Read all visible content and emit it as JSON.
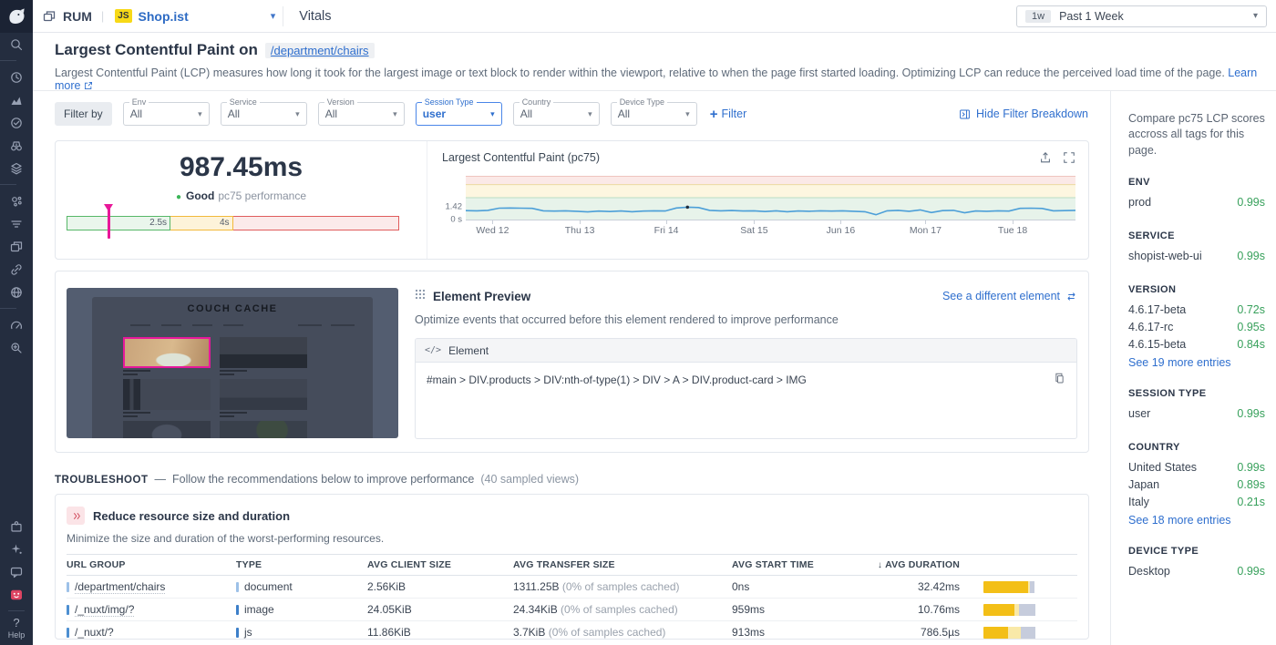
{
  "topbar": {
    "app_label": "RUM",
    "service_badge": "JS",
    "service_name": "Shop.ist",
    "tab_label": "Vitals",
    "time_range": {
      "badge": "1w",
      "label": "Past 1 Week"
    }
  },
  "icons": {
    "caret_down": "▾",
    "sort_down": "↓",
    "status_dot": "●",
    "dash": "—"
  },
  "sidebar": {
    "groups": [
      [
        "search"
      ],
      [
        "history",
        "bar-chart",
        "check-gauge",
        "binoculars",
        "layers"
      ],
      [
        "dot-cluster",
        "filter-lines",
        "browser-frames",
        "link",
        "globe"
      ],
      [
        "speedometer",
        "search-gear"
      ]
    ],
    "bottom_groups": [
      [
        "puzzle",
        "sparkles",
        "chat-bubble",
        "dog-alert"
      ]
    ],
    "help_label": "Help"
  },
  "header": {
    "title": "Largest Contentful Paint on",
    "path_chip": "/department/chairs",
    "description": "Largest Contentful Paint (LCP) measures how long it took for the largest image or text block to render within the viewport, relative to when the page first started loading. Optimizing LCP can reduce the perceived load time of the page.",
    "learn_more": "Learn more"
  },
  "filters": {
    "filter_by_label": "Filter by",
    "dropdowns": [
      {
        "label": "Env",
        "value": "All",
        "active": false
      },
      {
        "label": "Service",
        "value": "All",
        "active": false
      },
      {
        "label": "Version",
        "value": "All",
        "active": false
      },
      {
        "label": "Session Type",
        "value": "user",
        "active": true
      },
      {
        "label": "Country",
        "value": "All",
        "active": false
      },
      {
        "label": "Device Type",
        "value": "All",
        "active": false
      }
    ],
    "add_filter_label": "Filter",
    "hide_breakdown_label": "Hide Filter Breakdown"
  },
  "overview": {
    "value": "987.45ms",
    "status_word": "Good",
    "status_rest": "pc75 performance",
    "gauge": {
      "good": 2.5,
      "poor": 4,
      "max": 8,
      "value_s": 0.98745,
      "good_label": "2.5s",
      "poor_label": "4s"
    }
  },
  "chart_data": {
    "type": "line",
    "title": "Largest Contentful Paint (pc75)",
    "unit": "s",
    "ylim": [
      0,
      5
    ],
    "thresholds": {
      "good": 2.5,
      "poor": 4
    },
    "y_axis_labels": [
      {
        "text": "1.42",
        "value": 1.42
      },
      {
        "text": "0 s",
        "value": 0
      }
    ],
    "x_labels": [
      "Wed 12",
      "Thu 13",
      "Fri 14",
      "Sat 15",
      "Jun 16",
      "Mon 17",
      "Tue 18"
    ],
    "x_tick_fracs": [
      0.044,
      0.187,
      0.329,
      0.473,
      0.615,
      0.754,
      0.897
    ],
    "values": [
      1.02,
      1.0,
      1.05,
      1.3,
      1.32,
      1.3,
      1.28,
      1.0,
      0.97,
      1.0,
      0.95,
      0.88,
      0.97,
      0.92,
      0.98,
      0.9,
      0.97,
      1.0,
      0.98,
      1.32,
      1.42,
      1.38,
      1.05,
      1.0,
      1.03,
      0.98,
      1.0,
      0.92,
      1.0,
      0.9,
      0.98,
      0.95,
      1.0,
      0.97,
      1.0,
      0.95,
      0.9,
      0.55,
      1.0,
      1.05,
      0.95,
      1.1,
      0.8,
      1.02,
      1.05,
      0.78,
      0.98,
      0.95,
      1.0,
      0.97,
      1.28,
      1.3,
      1.27,
      1.0,
      1.02,
      1.05
    ],
    "marker_index": 20,
    "legend": []
  },
  "element_preview": {
    "title": "Element Preview",
    "link": "See a different element",
    "description": "Optimize events that occurred before this element rendered to improve performance",
    "panel_icon": "</>",
    "panel_title": "Element",
    "selector": "#main > DIV.products > DIV:nth-of-type(1) > DIV > A > DIV.product-card > IMG",
    "image_title": "COUCH CACHE"
  },
  "troubleshoot": {
    "label": "TROUBLESHOOT",
    "dash": "—",
    "text": "Follow the recommendations below to improve performance",
    "sample_note": "(40 sampled views)",
    "card": {
      "title": "Reduce resource size and duration",
      "subtitle": "Minimize the size and duration of the worst-performing resources.",
      "table": {
        "columns": [
          {
            "label": "URL GROUP"
          },
          {
            "label": "TYPE"
          },
          {
            "label": "AVG CLIENT SIZE"
          },
          {
            "label": "AVG TRANSFER SIZE"
          },
          {
            "label": "AVG START TIME"
          },
          {
            "label": "AVG DURATION",
            "sorted": true
          }
        ],
        "rows": [
          {
            "url": "/department/chairs",
            "url_chip": "#9dc1e8",
            "type": "document",
            "type_chip": "#9dc1e8",
            "client_size": "2.56KiB",
            "transfer_size": "1311.25B",
            "transfer_note": "(0% of samples cached)",
            "start_time": "0ns",
            "duration": "32.42ms",
            "bar": [
              84,
              4,
              8
            ]
          },
          {
            "url": "/_nuxt/img/?",
            "url_chip": "#4d8fd1",
            "type": "image",
            "type_chip": "#3c7fc9",
            "client_size": "24.05KiB",
            "transfer_size": "24.34KiB",
            "transfer_note": "(0% of samples cached)",
            "start_time": "959ms",
            "duration": "10.76ms",
            "bar": [
              58,
              10,
              30
            ]
          },
          {
            "url": "/_nuxt/?",
            "url_chip": "#4d8fd1",
            "type": "js",
            "type_chip": "#3c7fc9",
            "client_size": "11.86KiB",
            "transfer_size": "3.7KiB",
            "transfer_note": "(0% of samples cached)",
            "start_time": "913ms",
            "duration": "786.5µs",
            "bar": [
              46,
              24,
              28
            ]
          }
        ]
      }
    }
  },
  "breakdown_panel": {
    "intro": "Compare pc75 LCP scores accross all tags for this page.",
    "sections": [
      {
        "header": "ENV",
        "rows": [
          {
            "name": "prod",
            "value": "0.99s"
          }
        ]
      },
      {
        "header": "SERVICE",
        "rows": [
          {
            "name": "shopist-web-ui",
            "value": "0.99s"
          }
        ]
      },
      {
        "header": "VERSION",
        "rows": [
          {
            "name": "4.6.17-beta",
            "value": "0.72s"
          },
          {
            "name": "4.6.17-rc",
            "value": "0.95s"
          },
          {
            "name": "4.6.15-beta",
            "value": "0.84s"
          }
        ],
        "link": "See 19 more entries"
      },
      {
        "header": "SESSION TYPE",
        "rows": [
          {
            "name": "user",
            "value": "0.99s"
          }
        ]
      },
      {
        "header": "COUNTRY",
        "rows": [
          {
            "name": "United States",
            "value": "0.99s"
          },
          {
            "name": "Japan",
            "value": "0.89s"
          },
          {
            "name": "Italy",
            "value": "0.21s"
          }
        ],
        "link": "See 18 more entries"
      },
      {
        "header": "DEVICE TYPE",
        "rows": [
          {
            "name": "Desktop",
            "value": "0.99s"
          }
        ]
      }
    ]
  },
  "colors": {
    "accent_blue": "#2f6fce",
    "good_green": "#37a05b",
    "marker_magenta": "#e81899",
    "line_blue": "#4c9fd8",
    "band_good": "#e7f3ea",
    "band_mid": "#fdf6e0",
    "band_poor": "#fbe9e7",
    "band_line_good": "#b9ddc4",
    "band_line_mid": "#ecd9a2",
    "band_line_poor": "#efc4bf",
    "duration_bar_segments": [
      "#f3bf17",
      "#f9e9a8",
      "#c6ccdc"
    ]
  }
}
